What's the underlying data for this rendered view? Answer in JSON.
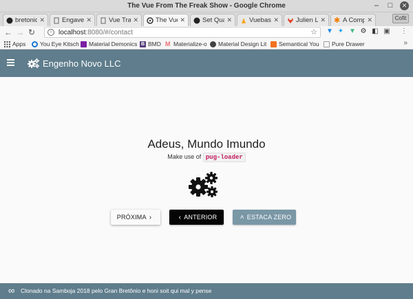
{
  "window": {
    "title": "The Vue From The Freak Show - Google Chrome"
  },
  "tabs": [
    {
      "label": "bretonic",
      "icon": "github-icon",
      "active": false
    },
    {
      "label": "Engaven",
      "icon": "page-icon",
      "active": false
    },
    {
      "label": "Vue Tran",
      "icon": "page-icon",
      "active": false
    },
    {
      "label": "The Vue",
      "icon": "biohazard-icon",
      "active": true
    },
    {
      "label": "Set Quac",
      "icon": "github-icon",
      "active": false
    },
    {
      "label": "Vuebase",
      "icon": "firebase-icon",
      "active": false
    },
    {
      "label": "Julien Li",
      "icon": "gitlab-icon",
      "active": false
    },
    {
      "label": "A Compl",
      "icon": "asterisk-icon",
      "active": false
    }
  ],
  "profile_label": "Cofit",
  "address": {
    "host": "localhost",
    "path": ":8080/#/contact"
  },
  "bookmarks": [
    {
      "label": "Apps",
      "color": "#e0492f"
    },
    {
      "label": "You Eye Kitsch",
      "color": "#1976d2"
    },
    {
      "label": "Material Demonics",
      "color": "#7b1fa2"
    },
    {
      "label": "BMD",
      "color": "#563d7c"
    },
    {
      "label": "Materialize-o",
      "color": "#ee6e73"
    },
    {
      "label": "Material Design Lit",
      "color": "#424242"
    },
    {
      "label": "Semantical You",
      "color": "#f2711c"
    },
    {
      "label": "Pure Drawer",
      "color": "#9e9e9e"
    }
  ],
  "app": {
    "brand": "Engenho Novo LLC",
    "header_color": "#5f7d8c"
  },
  "main": {
    "heading": "Adeus, Mundo Imundo",
    "subline_prefix": "Make use of",
    "code": "pug-loader"
  },
  "buttons": {
    "next": "PRÓXIMA",
    "previous": "ANTERIOR",
    "reset": "ESTACA ZERO"
  },
  "footer": {
    "text": "Clonado na Samboja 2018 pelo Gran Bretônio e honi soit qui mal y pense"
  }
}
